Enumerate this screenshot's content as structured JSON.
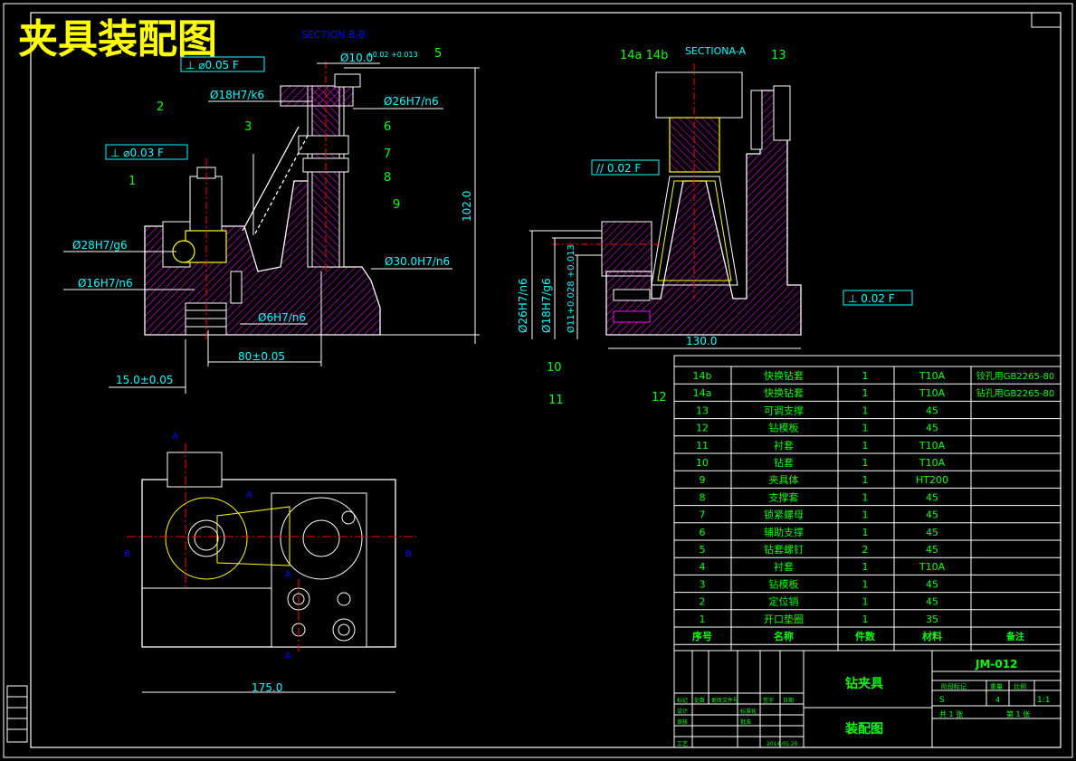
{
  "title": "夹具装配图",
  "section_bb": "SECTION B-B",
  "section_aa": "SECTIONA-A",
  "balloons": [
    "1",
    "2",
    "3",
    "5",
    "6",
    "7",
    "8",
    "9",
    "10",
    "11",
    "12",
    "13",
    "14a 14b"
  ],
  "tolerances": {
    "perp_005": "⊥ ⌀0.05 F",
    "perp_003": "⊥ ⌀0.03 F",
    "para_002": "// 0.02 F",
    "perp_002": "⊥ 0.02 F"
  },
  "dims": {
    "d10": "Ø10.0",
    "d10_tol": "+0.02 +0.013",
    "d18": "Ø18H7/k6",
    "d26": "Ø26H7/n6",
    "d28": "Ø28H7/g6",
    "d16": "Ø16H7/n6",
    "d30": "Ø30.0H7/n6",
    "d6": "Ø6H7/n6",
    "h102": "102.0",
    "l80": "80±0.05",
    "l15": "15.0±0.05",
    "l175": "175.0",
    "l130": "130.0",
    "v26": "Ø26H7/n6",
    "v18": "Ø18H7/g6",
    "v11": "Ø11+0.028 +0.013"
  },
  "view_labels": {
    "a": "A",
    "b": "B"
  },
  "bom_header": [
    "序号",
    "名称",
    "件数",
    "材料",
    "备注"
  ],
  "bom_rows": [
    [
      "14b",
      "快换钻套",
      "1",
      "T10A",
      "铰孔用GB2265-80"
    ],
    [
      "14a",
      "快换钻套",
      "1",
      "T10A",
      "钻孔用GB2265-80"
    ],
    [
      "13",
      "可调支撑",
      "1",
      "45",
      ""
    ],
    [
      "12",
      "钻模板",
      "1",
      "45",
      ""
    ],
    [
      "11",
      "衬套",
      "1",
      "T10A",
      ""
    ],
    [
      "10",
      "钻套",
      "1",
      "T10A",
      ""
    ],
    [
      "9",
      "夹具体",
      "1",
      "HT200",
      ""
    ],
    [
      "8",
      "支撑套",
      "1",
      "45",
      ""
    ],
    [
      "7",
      "锁紧螺母",
      "1",
      "45",
      ""
    ],
    [
      "6",
      "辅助支撑",
      "1",
      "45",
      ""
    ],
    [
      "5",
      "钻套螺钉",
      "2",
      "45",
      ""
    ],
    [
      "4",
      "衬套",
      "1",
      "T10A",
      ""
    ],
    [
      "3",
      "钻模板",
      "1",
      "45",
      ""
    ],
    [
      "2",
      "定位销",
      "1",
      "45",
      ""
    ],
    [
      "1",
      "开口垫圈",
      "1",
      "35",
      ""
    ]
  ],
  "title_block": {
    "part_name": "钻夹具",
    "drawing_name": "装配图",
    "code": "JM-012",
    "scale": "1:1",
    "sheet_count": "共 1 张",
    "sheet_no": "第 1 张",
    "date": "2014.05.20",
    "stage_label": "阶段标记",
    "weight_label": "重量",
    "scale_label": "比例",
    "mark_s": "S",
    "qty": "4",
    "design": "设计",
    "check": "审核",
    "process": "工艺",
    "std": "标准化",
    "approve": "批准",
    "mark": "标记",
    "count": "处数",
    "file": "更改文件号",
    "sign": "签字",
    "date_label": "日期"
  },
  "colors": {
    "title": "#ffff00",
    "line": "#ffffff",
    "cyan": "#00ffff",
    "green": "#00ff00",
    "red": "#ff0000",
    "blue": "#0000ff",
    "magenta": "#ff00ff"
  }
}
